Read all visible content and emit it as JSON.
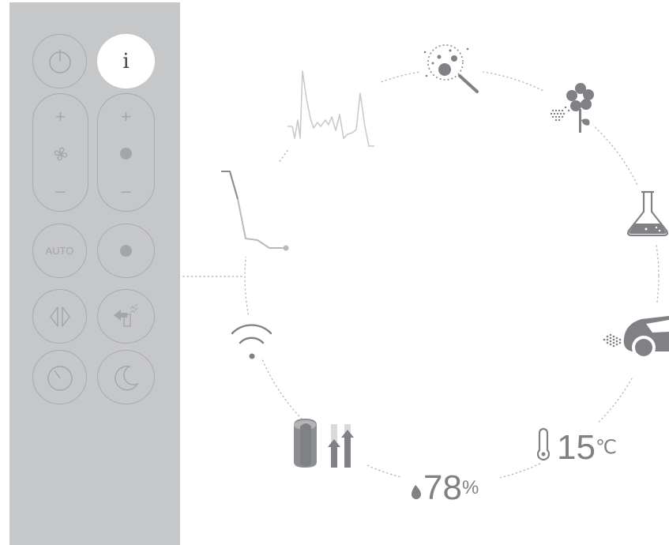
{
  "remote": {
    "info_symbol": "i",
    "auto_label": "AUTO",
    "plus_symbol": "+",
    "minus_symbol": "–",
    "buttons": [
      "power-icon",
      "info-icon",
      "fan-icon",
      "dot-icon",
      "auto",
      "dot-icon",
      "oscillation-icon",
      "direction-icon",
      "timer-icon",
      "night-mode-icon"
    ]
  },
  "readings": {
    "humidity_value": "78",
    "humidity_unit": "%",
    "temperature_value": "15",
    "temperature_unit": "℃"
  },
  "icons": [
    "microscope-particles-icon",
    "pollen-flower-icon",
    "chemical-flask-icon",
    "car-exhaust-icon",
    "wifi-icon",
    "filter-cylinder-icon",
    "humidity-drop-icon",
    "thermometer-icon",
    "history-graph-icon",
    "trend-graph-icon"
  ],
  "colors": {
    "remote_body": "#c6c7c9",
    "button_outline": "#a9aaad",
    "icon_gray": "#7f8184",
    "dotted_line": "#b7b8ba"
  }
}
